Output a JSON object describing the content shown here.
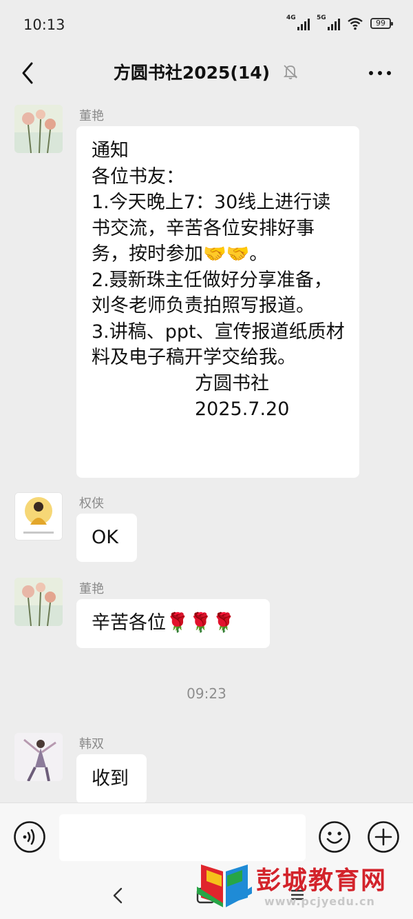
{
  "status_bar": {
    "time": "10:13",
    "network1": "4G",
    "network2": "5G",
    "battery": "99"
  },
  "header": {
    "title": "方圆书社2025(14)",
    "back_icon": "chevron-left-icon",
    "mute_icon": "bell-off-icon",
    "more_icon": "more-dots-icon"
  },
  "messages": [
    {
      "sender": "董艳",
      "text": "通知\n各位书友：\n1.今天晚上7：30线上进行读书交流，辛苦各位安排好事务，按时参加🤝🤝。\n2.聂新珠主任做好分享准备，刘冬老师负责拍照写报道。\n3.讲稿、ppt、宣传报道纸质材料及电子稿开学交给我。",
      "signature_org": "方圆书社",
      "signature_date": "2025.7.20"
    },
    {
      "sender": "权侠",
      "text": "OK"
    },
    {
      "sender": "董艳",
      "text": "辛苦各位🌹🌹🌹"
    },
    {
      "sender": "韩双",
      "text": "收到"
    }
  ],
  "time_divider": "09:23",
  "input_bar": {
    "voice_icon": "voice-icon",
    "emoji_icon": "emoji-icon",
    "plus_icon": "plus-icon"
  },
  "watermark": {
    "text": "彭城教育网",
    "url": "www.pcjyedu.cn"
  },
  "colors": {
    "background": "#ededed",
    "bubble": "#ffffff",
    "watermark_red": "#d3232b"
  }
}
